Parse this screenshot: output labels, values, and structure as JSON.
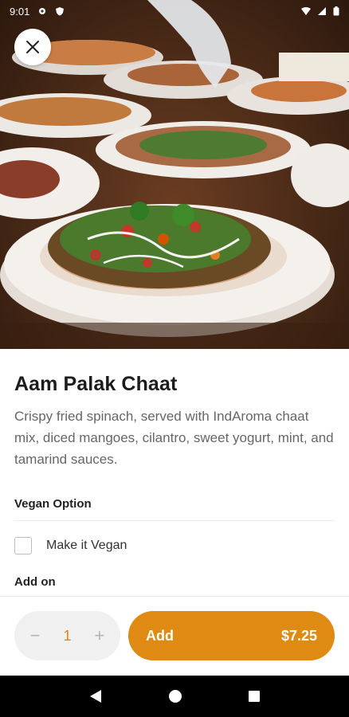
{
  "status_bar": {
    "time": "9:01"
  },
  "item": {
    "title": "Aam Palak Chaat",
    "description": "Crispy fried spinach, served with IndAroma chaat mix, diced mangoes, cilantro, sweet yogurt, mint, and tamarind sauces."
  },
  "sections": {
    "vegan": {
      "heading": "Vegan Option",
      "option_label": "Make it Vegan",
      "checked": false
    },
    "addon": {
      "heading": "Add on"
    }
  },
  "order": {
    "quantity": "1",
    "decrement_symbol": "−",
    "increment_symbol": "+",
    "add_label": "Add",
    "price": "$7.25"
  },
  "colors": {
    "accent": "#df8a12",
    "quantity_text": "#d9861a"
  },
  "icons": {
    "close": "close-icon",
    "back": "nav-back-icon",
    "home": "nav-home-icon",
    "recents": "nav-recents-icon"
  }
}
